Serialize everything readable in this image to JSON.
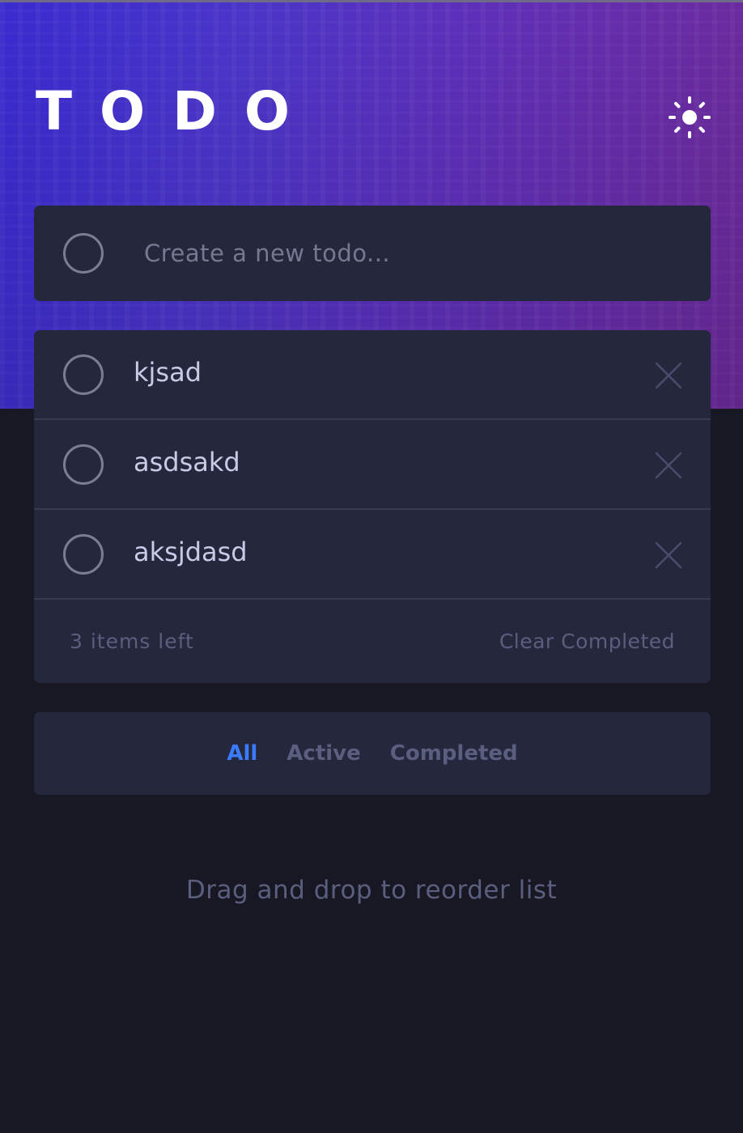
{
  "header": {
    "title": "TODO",
    "theme_toggle_icon": "sun-icon"
  },
  "create": {
    "placeholder": "Create a new todo...",
    "value": ""
  },
  "todos": [
    {
      "text": "kjsad",
      "completed": false
    },
    {
      "text": "asdsakd",
      "completed": false
    },
    {
      "text": "aksjdasd",
      "completed": false
    }
  ],
  "footer": {
    "items_left": "3 items left",
    "clear_label": "Clear Completed"
  },
  "filters": {
    "all": "All",
    "active": "Active",
    "completed": "Completed",
    "selected": "All"
  },
  "hint": "Drag and drop to reorder list",
  "colors": {
    "accent": "#3a7cfd",
    "card": "#25273d",
    "background": "#171823",
    "text": "#c8cbe7",
    "muted": "#5b5e7e"
  }
}
